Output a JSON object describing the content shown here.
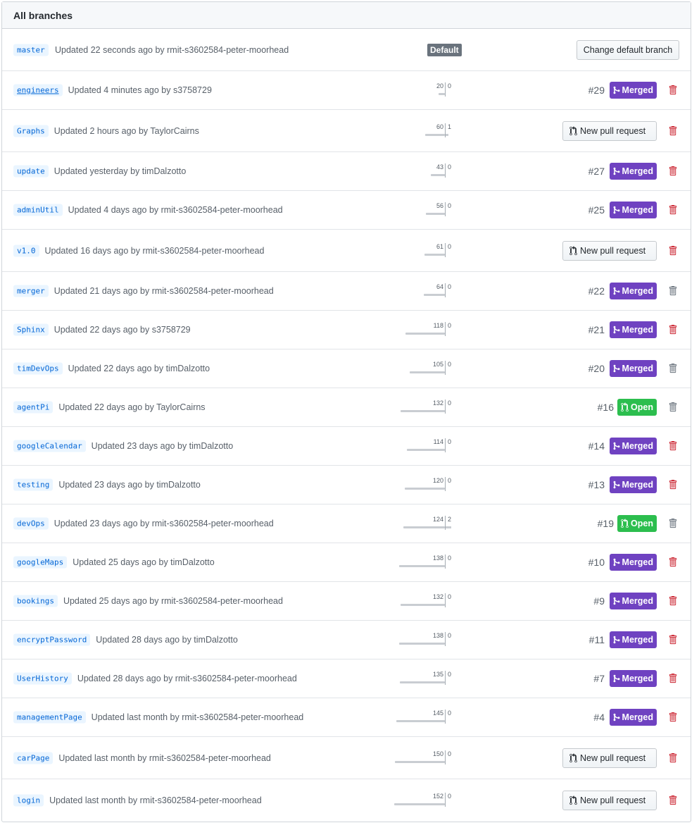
{
  "header": {
    "title": "All branches"
  },
  "default_branch": {
    "name": "master",
    "updated": "Updated 22 seconds ago by rmit-s3602584-peter-moorhead",
    "badge": "Default",
    "button": "Change default branch"
  },
  "labels": {
    "new_pr": "New pull request",
    "merged": "Merged",
    "open": "Open"
  },
  "colors": {
    "merged": "#6f42c1",
    "open": "#2cbe4e",
    "link": "#0366d6",
    "trash_red": "#cb2431",
    "trash_gray": "#6a737d"
  },
  "branches": [
    {
      "name": "engineers",
      "updated": "Updated 4 minutes ago by s3758729",
      "behind": "20",
      "ahead": "0",
      "pr": "#29",
      "status": "merged",
      "trash": "red"
    },
    {
      "name": "Graphs",
      "updated": "Updated 2 hours ago by TaylorCairns",
      "behind": "60",
      "ahead": "1",
      "pr": "",
      "status": "new",
      "trash": "red"
    },
    {
      "name": "update",
      "updated": "Updated yesterday by timDalzotto",
      "behind": "43",
      "ahead": "0",
      "pr": "#27",
      "status": "merged",
      "trash": "red"
    },
    {
      "name": "adminUtil",
      "updated": "Updated 4 days ago by rmit-s3602584-peter-moorhead",
      "behind": "56",
      "ahead": "0",
      "pr": "#25",
      "status": "merged",
      "trash": "red"
    },
    {
      "name": "v1.0",
      "updated": "Updated 16 days ago by rmit-s3602584-peter-moorhead",
      "behind": "61",
      "ahead": "0",
      "pr": "",
      "status": "new",
      "trash": "red"
    },
    {
      "name": "merger",
      "updated": "Updated 21 days ago by rmit-s3602584-peter-moorhead",
      "behind": "64",
      "ahead": "0",
      "pr": "#22",
      "status": "merged",
      "trash": "gray"
    },
    {
      "name": "Sphinx",
      "updated": "Updated 22 days ago by s3758729",
      "behind": "118",
      "ahead": "0",
      "pr": "#21",
      "status": "merged",
      "trash": "red"
    },
    {
      "name": "timDevOps",
      "updated": "Updated 22 days ago by timDalzotto",
      "behind": "105",
      "ahead": "0",
      "pr": "#20",
      "status": "merged",
      "trash": "gray"
    },
    {
      "name": "agentPi",
      "updated": "Updated 22 days ago by TaylorCairns",
      "behind": "132",
      "ahead": "0",
      "pr": "#16",
      "status": "open",
      "trash": "gray"
    },
    {
      "name": "googleCalendar",
      "updated": "Updated 23 days ago by timDalzotto",
      "behind": "114",
      "ahead": "0",
      "pr": "#14",
      "status": "merged",
      "trash": "red"
    },
    {
      "name": "testing",
      "updated": "Updated 23 days ago by timDalzotto",
      "behind": "120",
      "ahead": "0",
      "pr": "#13",
      "status": "merged",
      "trash": "red"
    },
    {
      "name": "devOps",
      "updated": "Updated 23 days ago by rmit-s3602584-peter-moorhead",
      "behind": "124",
      "ahead": "2",
      "pr": "#19",
      "status": "open",
      "trash": "gray"
    },
    {
      "name": "googleMaps",
      "updated": "Updated 25 days ago by timDalzotto",
      "behind": "138",
      "ahead": "0",
      "pr": "#10",
      "status": "merged",
      "trash": "red"
    },
    {
      "name": "bookings",
      "updated": "Updated 25 days ago by rmit-s3602584-peter-moorhead",
      "behind": "132",
      "ahead": "0",
      "pr": "#9",
      "status": "merged",
      "trash": "red"
    },
    {
      "name": "encryptPassword",
      "updated": "Updated 28 days ago by timDalzotto",
      "behind": "138",
      "ahead": "0",
      "pr": "#11",
      "status": "merged",
      "trash": "red"
    },
    {
      "name": "UserHistory",
      "updated": "Updated 28 days ago by rmit-s3602584-peter-moorhead",
      "behind": "135",
      "ahead": "0",
      "pr": "#7",
      "status": "merged",
      "trash": "red"
    },
    {
      "name": "managementPage",
      "updated": "Updated last month by rmit-s3602584-peter-moorhead",
      "behind": "145",
      "ahead": "0",
      "pr": "#4",
      "status": "merged",
      "trash": "red"
    },
    {
      "name": "carPage",
      "updated": "Updated last month by rmit-s3602584-peter-moorhead",
      "behind": "150",
      "ahead": "0",
      "pr": "",
      "status": "new",
      "trash": "red"
    },
    {
      "name": "login",
      "updated": "Updated last month by rmit-s3602584-peter-moorhead",
      "behind": "152",
      "ahead": "0",
      "pr": "",
      "status": "new",
      "trash": "red"
    }
  ]
}
